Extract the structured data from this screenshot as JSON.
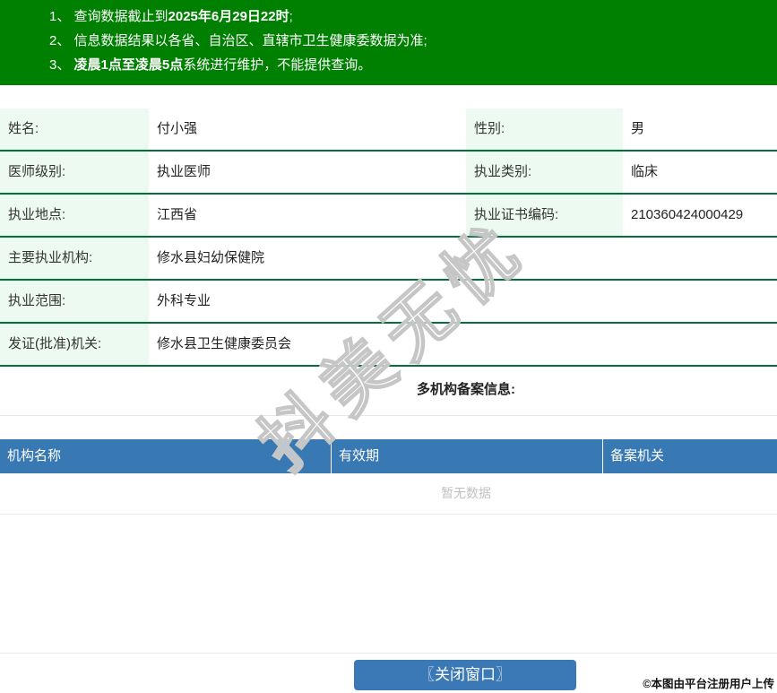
{
  "notices": {
    "lines": [
      {
        "pre": "1、 查询数据截止到",
        "bold": "2025年6月29日22时",
        "post": ";"
      },
      {
        "pre": "2、 信息数据结果以各省、自治区、直辖市卫生健康委数据为准;",
        "bold": "",
        "post": ""
      },
      {
        "pre": "3、 ",
        "bold": "凌晨1点至凌晨5点",
        "post": "系统进行维护，不能提供查询。"
      }
    ]
  },
  "profile": {
    "rows": [
      {
        "label1": "姓名:",
        "value1": "付小强",
        "label2": "性别:",
        "value2": "男"
      },
      {
        "label1": "医师级别:",
        "value1": "执业医师",
        "label2": "执业类别:",
        "value2": "临床"
      },
      {
        "label1": "执业地点:",
        "value1": "江西省",
        "label2": "执业证书编码:",
        "value2": "210360424000429"
      },
      {
        "label": "主要执业机构:",
        "value": "修水县妇幼保健院"
      },
      {
        "label": "执业范围:",
        "value": "外科专业"
      },
      {
        "label": "发证(批准)机关:",
        "value": "修水县卫生健康委员会"
      }
    ]
  },
  "records": {
    "title": "多机构备案信息:",
    "columns": [
      "机构名称",
      "有效期",
      "备案机关"
    ],
    "empty_text": "暂无数据"
  },
  "footer": {
    "close_button": "〖关闭窗口〗",
    "attribution": "©本图由平台注册用户上传"
  },
  "watermark": "抖美无忧",
  "colors": {
    "green": "#008000",
    "mint": "#edfaf2",
    "dgreen": "#06703c",
    "blue": "#3879b3",
    "btn-blue": "#3a79b5",
    "empty": "#c0c0c0"
  }
}
